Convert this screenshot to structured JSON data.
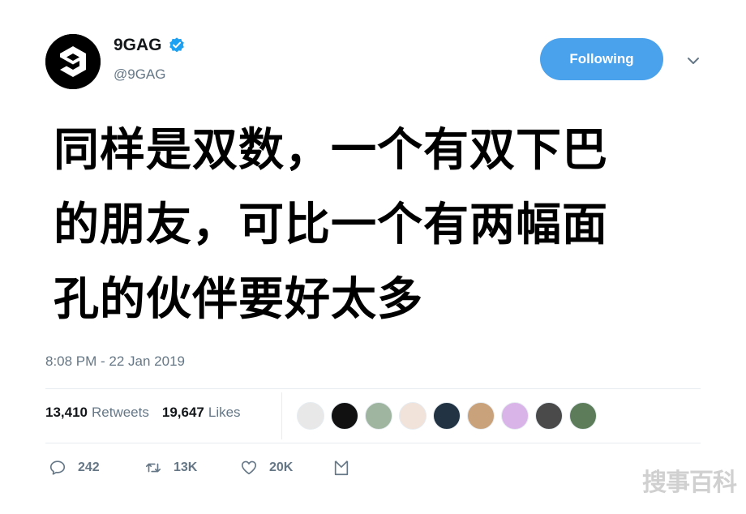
{
  "user": {
    "display_name": "9GAG",
    "handle": "@9GAG",
    "verified": true,
    "avatar_icon": "9gag-logo-icon"
  },
  "follow_button": {
    "label": "Following",
    "color": "#4aa1ec"
  },
  "tweet": {
    "lines": [
      "同样是双数，一个有双下巴",
      "的朋友，可比一个有两幅面",
      "孔的伙伴要好太多"
    ],
    "timestamp": "8:08 PM - 22 Jan 2019"
  },
  "stats": {
    "retweets_count": "13,410",
    "retweets_label": "Retweets",
    "likes_count": "19,647",
    "likes_label": "Likes"
  },
  "likers": [
    {
      "icon": "liker-avatar-1",
      "color": "#e8e8e8"
    },
    {
      "icon": "liker-avatar-2",
      "color": "#111111"
    },
    {
      "icon": "liker-avatar-3",
      "color": "#9fb5a0"
    },
    {
      "icon": "liker-avatar-4",
      "color": "#f1e2da"
    },
    {
      "icon": "liker-avatar-5",
      "color": "#223344"
    },
    {
      "icon": "liker-avatar-6",
      "color": "#c9a27b"
    },
    {
      "icon": "liker-avatar-7",
      "color": "#d9b4e8"
    },
    {
      "icon": "liker-avatar-8",
      "color": "#4a4a4a"
    },
    {
      "icon": "liker-avatar-9",
      "color": "#5d7d5a"
    }
  ],
  "actions": {
    "reply_count": "242",
    "retweet_count": "13K",
    "like_count": "20K"
  },
  "watermark": "搜事百科",
  "colors": {
    "accent": "#4aa1ec",
    "verified": "#1da1f2",
    "secondary_text": "#657786"
  }
}
